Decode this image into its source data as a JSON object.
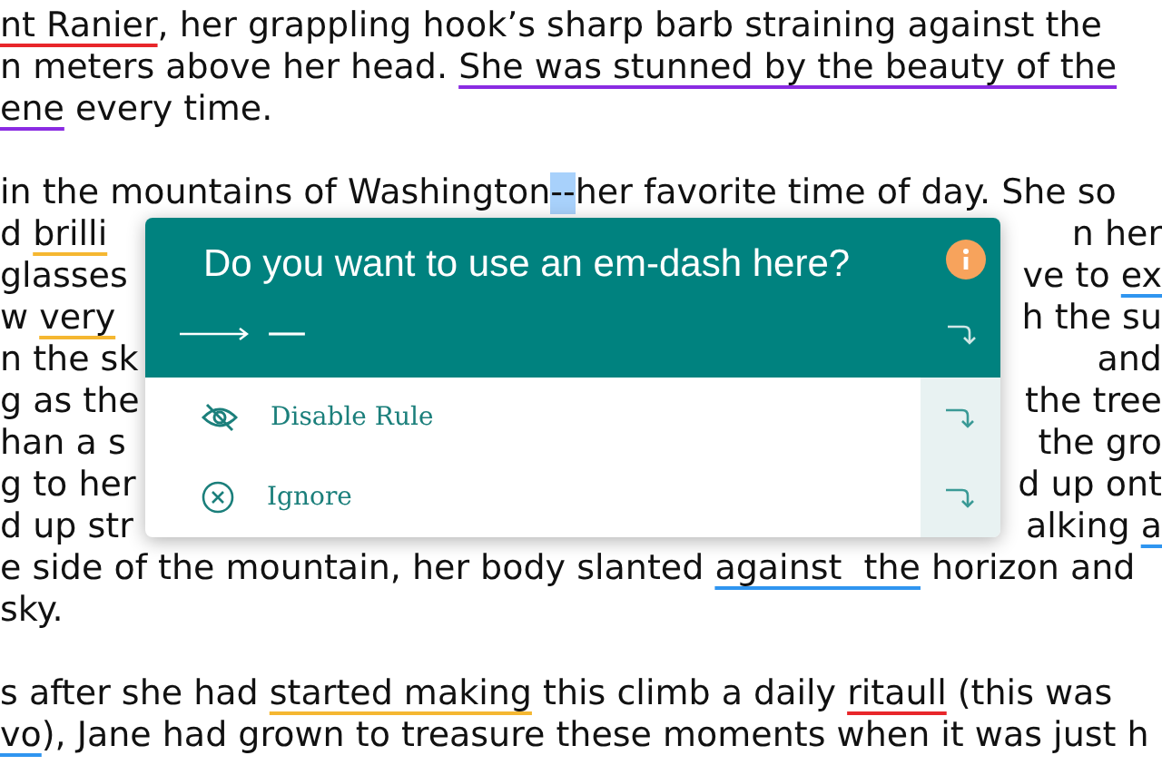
{
  "paragraphs": [
    {
      "lines": [
        {
          "left": [
            {
              "kind": "underlined",
              "color": "#e8262a",
              "text": "nt Ranier"
            },
            {
              "kind": "plain",
              "text": ", her grappling hook’s sharp barb straining against the"
            }
          ]
        },
        {
          "left": [
            {
              "kind": "plain",
              "text": "n meters above her head. "
            },
            {
              "kind": "underlined",
              "color": "#8a2be2",
              "text": "She was stunned by the beauty of the"
            }
          ]
        },
        {
          "left": [
            {
              "kind": "underlined",
              "color": "#8a2be2",
              "text": "ene"
            },
            {
              "kind": "plain",
              "text": " every time."
            }
          ]
        }
      ]
    },
    {
      "lines": [
        {
          "left": [
            {
              "kind": "plain",
              "text": "in the mountains of Washington"
            },
            {
              "kind": "highlighted",
              "color": "#a8d1fb",
              "text": "--"
            },
            {
              "kind": "plain",
              "text": "her favorite time of day. She so"
            }
          ]
        },
        {
          "left": [
            {
              "kind": "plain",
              "text": "d "
            },
            {
              "kind": "underlined",
              "color": "#f5b731",
              "text": "brilli"
            }
          ],
          "right": [
            {
              "kind": "plain",
              "text": "n her"
            }
          ]
        },
        {
          "left": [
            {
              "kind": "plain",
              "text": "glasses"
            }
          ],
          "right": [
            {
              "kind": "plain",
              "text": "ve to "
            },
            {
              "kind": "underlined",
              "color": "#2f95f0",
              "text": "ex"
            }
          ]
        },
        {
          "left": [
            {
              "kind": "plain",
              "text": "w "
            },
            {
              "kind": "underlined",
              "color": "#f5b731",
              "text": "very"
            }
          ],
          "right": [
            {
              "kind": "plain",
              "text": "h the su"
            }
          ]
        },
        {
          "left": [
            {
              "kind": "plain",
              "text": "n the sk"
            }
          ],
          "right": [
            {
              "kind": "plain",
              "text": "and"
            }
          ]
        },
        {
          "left": [
            {
              "kind": "plain",
              "text": "g as the"
            }
          ],
          "right": [
            {
              "kind": "plain",
              "text": "the tree"
            }
          ]
        },
        {
          "left": [
            {
              "kind": "plain",
              "text": "han a s"
            }
          ],
          "right": [
            {
              "kind": "plain",
              "text": "the gro"
            }
          ]
        },
        {
          "left": [
            {
              "kind": "plain",
              "text": "g to her"
            }
          ],
          "right": [
            {
              "kind": "plain",
              "text": "d up ont"
            }
          ]
        },
        {
          "left": [
            {
              "kind": "plain",
              "text": "d up str"
            }
          ],
          "right": [
            {
              "kind": "plain",
              "text": "alking "
            },
            {
              "kind": "underlined",
              "color": "#2f95f0",
              "text": "a"
            }
          ]
        },
        {
          "left": [
            {
              "kind": "plain",
              "text": "e side of the mountain, her body slanted "
            },
            {
              "kind": "underlined",
              "color": "#2f95f0",
              "text": "against  the"
            },
            {
              "kind": "plain",
              "text": " horizon and"
            }
          ]
        },
        {
          "left": [
            {
              "kind": "plain",
              "text": "sky."
            }
          ]
        }
      ]
    },
    {
      "lines": [
        {
          "left": [
            {
              "kind": "plain",
              "text": "s after she had "
            },
            {
              "kind": "underlined",
              "color": "#f5b731",
              "text": "started making"
            },
            {
              "kind": "plain",
              "text": " this climb a daily "
            },
            {
              "kind": "underlined",
              "color": "#e8262a",
              "text": "ritaull"
            },
            {
              "kind": "plain",
              "text": " (this was"
            }
          ]
        },
        {
          "left": [
            {
              "kind": "underlined",
              "color": "#2f95f0",
              "text": "vo"
            },
            {
              "kind": "plain",
              "text": "), Jane had grown to treasure these moments when it was just h"
            }
          ]
        }
      ]
    }
  ],
  "popup": {
    "title": "Do you want to use an em-dash here?",
    "suggestion": "—",
    "options": [
      {
        "kind": "disable",
        "label": "Disable Rule"
      },
      {
        "kind": "ignore",
        "label": "Ignore"
      }
    ]
  }
}
